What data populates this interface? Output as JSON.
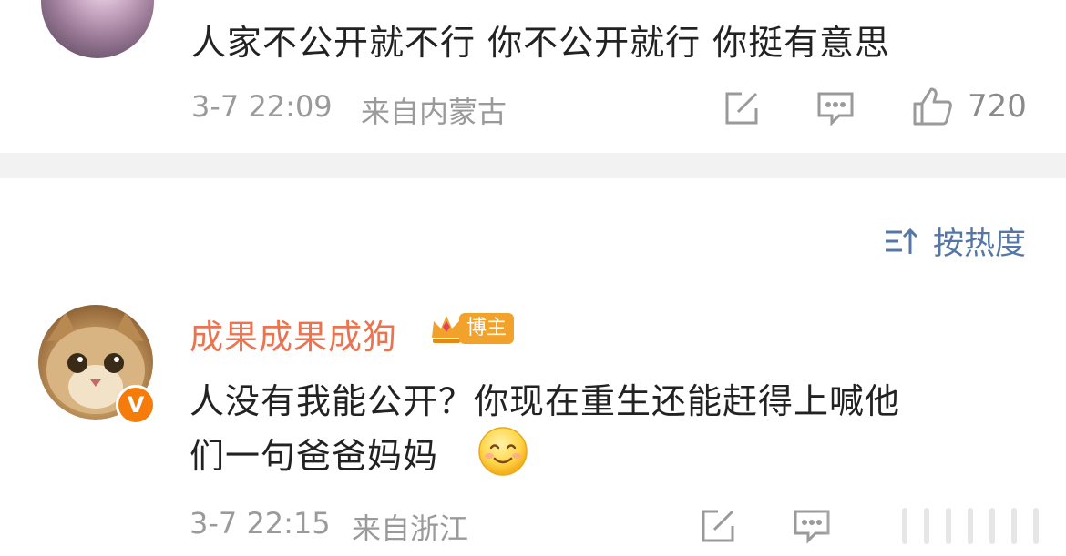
{
  "comment1": {
    "text": "人家不公开就不行  你不公开就行  你挺有意思",
    "time": "3-7 22:09",
    "location": "来自内蒙古",
    "like_count": "720"
  },
  "sort": {
    "label": "按热度"
  },
  "comment2": {
    "username": "成果成果成狗",
    "badge": "博主",
    "line1": "人没有我能公开？你现在重生还能赶得上喊他",
    "line2": "们一句爸爸妈妈",
    "time": "3-7 22:15",
    "location": "来自浙江"
  },
  "colors": {
    "username": "#eb7350",
    "sort": "#5477a6",
    "meta": "#9a9a9a",
    "verified": "#f57c0b"
  }
}
